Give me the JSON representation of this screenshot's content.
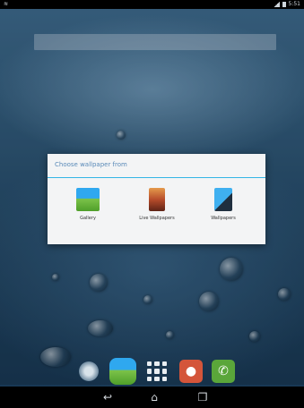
{
  "status_bar": {
    "left_icons": [
      "wifi-icon"
    ],
    "time": "5:51"
  },
  "search": {
    "placeholder": ""
  },
  "dialog": {
    "title": "Choose wallpaper from",
    "accent_color": "#33b5e5",
    "options": [
      {
        "label": "Gallery",
        "icon": "gallery-icon"
      },
      {
        "label": "Live Wallpapers",
        "icon": "live-wallpapers-icon"
      },
      {
        "label": "Wallpapers",
        "icon": "wallpapers-icon"
      }
    ]
  },
  "dock": {
    "items": [
      {
        "icon": "browser-icon"
      },
      {
        "icon": "gallery-icon"
      },
      {
        "icon": "all-apps-icon"
      },
      {
        "icon": "contacts-icon"
      },
      {
        "icon": "phone-icon"
      }
    ]
  },
  "nav": {
    "back_glyph": "↩",
    "home_glyph": "⌂",
    "recents_glyph": "❐"
  }
}
